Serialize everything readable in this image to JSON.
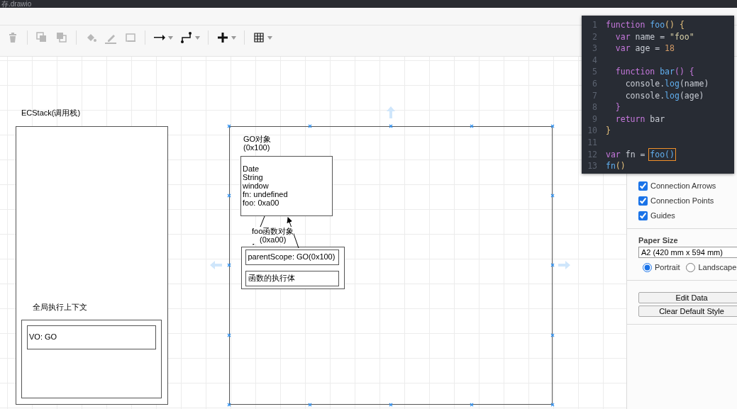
{
  "title": "存.drawio",
  "toolbar": [
    {
      "kind": "delete",
      "disabled": true,
      "menu": false
    },
    {
      "kind": "separator"
    },
    {
      "kind": "to-front",
      "disabled": true,
      "menu": false
    },
    {
      "kind": "to-back",
      "disabled": true,
      "menu": false
    },
    {
      "kind": "separator"
    },
    {
      "kind": "fill-color",
      "disabled": true,
      "menu": false
    },
    {
      "kind": "line-color",
      "disabled": true,
      "menu": false
    },
    {
      "kind": "shadow",
      "disabled": true,
      "menu": false
    },
    {
      "kind": "separator"
    },
    {
      "kind": "connection",
      "disabled": false,
      "menu": true
    },
    {
      "kind": "waypoints",
      "disabled": false,
      "menu": true
    },
    {
      "kind": "separator"
    },
    {
      "kind": "insert",
      "disabled": false,
      "menu": true
    },
    {
      "kind": "separator"
    },
    {
      "kind": "table",
      "disabled": false,
      "menu": true
    }
  ],
  "diagram": {
    "stack_label": "ECStack(调用栈)",
    "context_label": "全局执行上下文",
    "vo": "VO: GO",
    "go_frame_selected": true,
    "go_label": "GO对象\n(0x100)",
    "go_members": "Date\nString\nwindow\nfn: undefined\nfoo: 0xa00",
    "foo_label": "foo函数对象\n(0xa00)",
    "foo_fields": [
      "parentScope: GO(0x100)",
      "函数的执行体"
    ]
  },
  "code": [
    {
      "number": "1",
      "tokens": [
        {
          "text": "function ",
          "kind": "keyword"
        },
        {
          "text": "foo",
          "kind": "fn"
        },
        {
          "text": "()",
          "kind": "paren"
        },
        {
          "text": " {",
          "kind": "paren"
        }
      ]
    },
    {
      "number": "2",
      "tokens": [
        {
          "text": "  var",
          "kind": "keyword"
        },
        {
          "text": " name = ",
          "kind": "plain"
        },
        {
          "text": "\"foo\"",
          "kind": "string"
        }
      ]
    },
    {
      "number": "3",
      "tokens": [
        {
          "text": "  var",
          "kind": "keyword"
        },
        {
          "text": " age = ",
          "kind": "plain"
        },
        {
          "text": "18",
          "kind": "number"
        }
      ]
    },
    {
      "number": "4"
    },
    {
      "number": "5",
      "tokens": [
        {
          "text": "  function ",
          "kind": "keyword"
        },
        {
          "text": "bar",
          "kind": "fn"
        },
        {
          "text": "() {",
          "kind": "keyword"
        }
      ]
    },
    {
      "number": "6",
      "tokens": [
        {
          "text": "    console.",
          "kind": "plain"
        },
        {
          "text": "log",
          "kind": "fn"
        },
        {
          "text": "(name)",
          "kind": "plain"
        }
      ]
    },
    {
      "number": "7",
      "tokens": [
        {
          "text": "    console.",
          "kind": "plain"
        },
        {
          "text": "log",
          "kind": "fn"
        },
        {
          "text": "(age)",
          "kind": "plain"
        }
      ]
    },
    {
      "number": "8",
      "tokens": [
        {
          "text": "  }",
          "kind": "keyword"
        }
      ]
    },
    {
      "number": "9",
      "tokens": [
        {
          "text": "  return",
          "kind": "keyword"
        },
        {
          "text": " bar",
          "kind": "plain"
        }
      ]
    },
    {
      "number": "10",
      "tokens": [
        {
          "text": "}",
          "kind": "paren"
        }
      ]
    },
    {
      "number": "11"
    },
    {
      "number": "12",
      "tokens": [
        {
          "text": "var",
          "kind": "keyword"
        },
        {
          "text": " fn = ",
          "kind": "plain"
        },
        {
          "text": "foo()",
          "kind": "selected"
        }
      ]
    },
    {
      "number": "13",
      "tokens": [
        {
          "text": "fn",
          "kind": "fn"
        },
        {
          "text": "()",
          "kind": "paren"
        }
      ]
    }
  ],
  "panel": {
    "options": [
      {
        "label": "Connection Arrows",
        "checked": true
      },
      {
        "label": "Connection Points",
        "checked": true
      },
      {
        "label": "Guides",
        "checked": true
      }
    ],
    "paper_size_title": "Paper Size",
    "paper_size": "A2 (420 mm x 594 mm)",
    "orientation": [
      {
        "label": "Portrait",
        "selected": true
      },
      {
        "label": "Landscape",
        "selected": false
      }
    ],
    "buttons": [
      "Edit Data",
      "Clear Default Style"
    ]
  }
}
